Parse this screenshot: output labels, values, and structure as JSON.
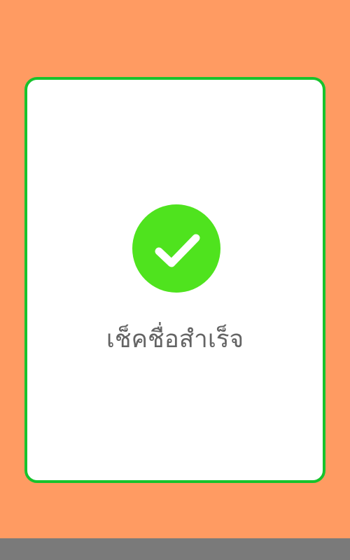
{
  "dialog": {
    "status_icon": "check-circle-icon",
    "message": "เช็คชื่อสำเร็จ"
  },
  "colors": {
    "background": "#FF9B62",
    "card_border": "#17C32C",
    "check_circle": "#4FE31E",
    "text": "#646464",
    "bottom_bar": "#7A7A7A"
  }
}
